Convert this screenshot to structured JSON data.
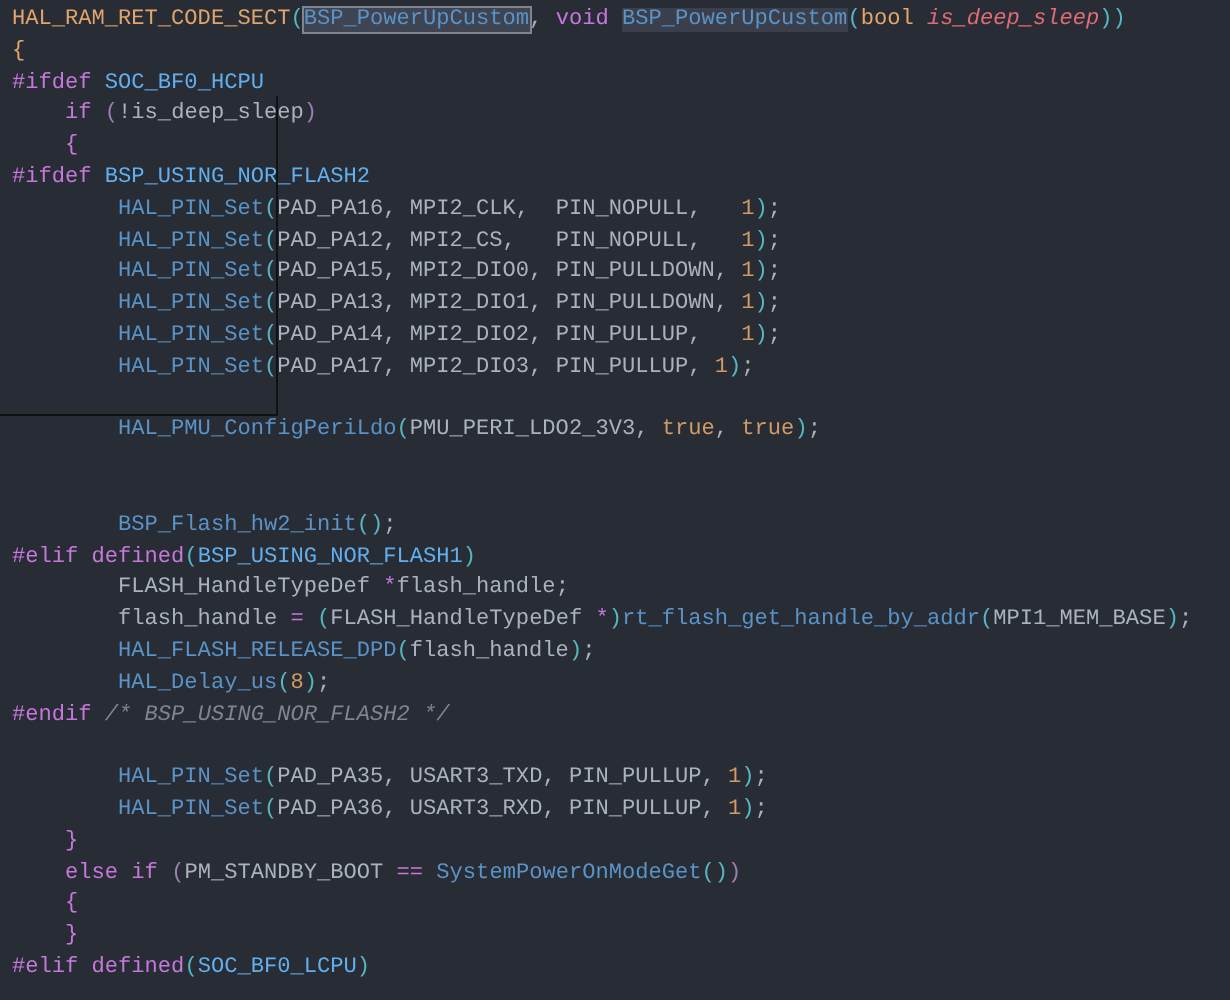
{
  "editor": {
    "lines": [
      {
        "kind": "code",
        "tokens": [
          {
            "text": "HAL_RAM_RET_CODE_SECT",
            "kind": "macro"
          },
          {
            "text": "(",
            "kind": "punct"
          },
          {
            "text": "BSP_PowerUpCustom",
            "kind": "func",
            "selected": true
          },
          {
            "text": ", ",
            "kind": "plain"
          },
          {
            "text": "void ",
            "kind": "keyword"
          },
          {
            "text": "BSP_PowerUpCustom",
            "kind": "func",
            "highlighted": true
          },
          {
            "text": "(",
            "kind": "punct"
          },
          {
            "text": "bool ",
            "kind": "type"
          },
          {
            "text": "is_deep_sleep",
            "kind": "param"
          },
          {
            "text": "))",
            "kind": "punct"
          }
        ]
      },
      {
        "kind": "code",
        "tokens": [
          {
            "text": "{",
            "kind": "type"
          }
        ]
      },
      {
        "kind": "code",
        "tokens": [
          {
            "text": "#ifdef",
            "kind": "keyword"
          },
          {
            "text": " SOC_BF0_HCPU",
            "kind": "defname"
          }
        ]
      },
      {
        "kind": "code",
        "tokens": [
          {
            "text": "    if ",
            "kind": "keyword"
          },
          {
            "text": "(",
            "kind": "dimpunct"
          },
          {
            "text": "!is_deep_sleep",
            "kind": "plain"
          },
          {
            "text": ")",
            "kind": "dimpunct"
          }
        ]
      },
      {
        "kind": "code",
        "tokens": [
          {
            "text": "    {",
            "kind": "keyword"
          }
        ]
      },
      {
        "kind": "code",
        "tokens": [
          {
            "text": "#ifdef",
            "kind": "keyword"
          },
          {
            "text": " BSP_USING_NOR_FLASH2",
            "kind": "defname"
          }
        ]
      },
      {
        "kind": "code",
        "tokens": [
          {
            "text": "        HAL_PIN_Set",
            "kind": "func"
          },
          {
            "text": "(",
            "kind": "punct"
          },
          {
            "text": "PAD_PA16, MPI2_CLK,  PIN_NOPULL,   ",
            "kind": "plain"
          },
          {
            "text": "1",
            "kind": "number"
          },
          {
            "text": ")",
            "kind": "punct"
          },
          {
            "text": ";",
            "kind": "plain"
          }
        ]
      },
      {
        "kind": "code",
        "tokens": [
          {
            "text": "        HAL_PIN_Set",
            "kind": "func"
          },
          {
            "text": "(",
            "kind": "punct"
          },
          {
            "text": "PAD_PA12, MPI2_CS,   PIN_NOPULL,   ",
            "kind": "plain"
          },
          {
            "text": "1",
            "kind": "number"
          },
          {
            "text": ")",
            "kind": "punct"
          },
          {
            "text": ";",
            "kind": "plain"
          }
        ]
      },
      {
        "kind": "code",
        "tokens": [
          {
            "text": "        HAL_PIN_Set",
            "kind": "func"
          },
          {
            "text": "(",
            "kind": "punct"
          },
          {
            "text": "PAD_PA15, MPI2_DIO0, PIN_PULLDOWN, ",
            "kind": "plain"
          },
          {
            "text": "1",
            "kind": "number"
          },
          {
            "text": ")",
            "kind": "punct"
          },
          {
            "text": ";",
            "kind": "plain"
          }
        ]
      },
      {
        "kind": "code",
        "tokens": [
          {
            "text": "        HAL_PIN_Set",
            "kind": "func"
          },
          {
            "text": "(",
            "kind": "punct"
          },
          {
            "text": "PAD_PA13, MPI2_DIO1, PIN_PULLDOWN, ",
            "kind": "plain"
          },
          {
            "text": "1",
            "kind": "number"
          },
          {
            "text": ")",
            "kind": "punct"
          },
          {
            "text": ";",
            "kind": "plain"
          }
        ]
      },
      {
        "kind": "code",
        "tokens": [
          {
            "text": "        HAL_PIN_Set",
            "kind": "func"
          },
          {
            "text": "(",
            "kind": "punct"
          },
          {
            "text": "PAD_PA14, MPI2_DIO2, PIN_PULLUP,   ",
            "kind": "plain"
          },
          {
            "text": "1",
            "kind": "number"
          },
          {
            "text": ")",
            "kind": "punct"
          },
          {
            "text": ";",
            "kind": "plain"
          }
        ]
      },
      {
        "kind": "code",
        "tokens": [
          {
            "text": "        HAL_PIN_Set",
            "kind": "func"
          },
          {
            "text": "(",
            "kind": "punct"
          },
          {
            "text": "PAD_PA17, MPI2_DIO3, PIN_PULLUP, ",
            "kind": "plain"
          },
          {
            "text": "1",
            "kind": "number"
          },
          {
            "text": ")",
            "kind": "punct"
          },
          {
            "text": ";",
            "kind": "plain"
          }
        ]
      },
      {
        "kind": "blank"
      },
      {
        "kind": "code",
        "tokens": [
          {
            "text": "        HAL_PMU_ConfigPeriLdo",
            "kind": "func"
          },
          {
            "text": "(",
            "kind": "punct"
          },
          {
            "text": "PMU_PERI_LDO2_3V3, ",
            "kind": "plain"
          },
          {
            "text": "true",
            "kind": "number"
          },
          {
            "text": ", ",
            "kind": "plain"
          },
          {
            "text": "true",
            "kind": "number"
          },
          {
            "text": ")",
            "kind": "punct"
          },
          {
            "text": ";",
            "kind": "plain"
          }
        ]
      },
      {
        "kind": "blank"
      },
      {
        "kind": "blank"
      },
      {
        "kind": "code",
        "tokens": [
          {
            "text": "        BSP_Flash_hw2_init",
            "kind": "func"
          },
          {
            "text": "()",
            "kind": "punct"
          },
          {
            "text": ";",
            "kind": "plain"
          }
        ]
      },
      {
        "kind": "code",
        "tokens": [
          {
            "text": "#elif defined",
            "kind": "keyword"
          },
          {
            "text": "(",
            "kind": "punct"
          },
          {
            "text": "BSP_USING_NOR_FLASH1",
            "kind": "defname"
          },
          {
            "text": ")",
            "kind": "punct"
          }
        ]
      },
      {
        "kind": "code",
        "tokens": [
          {
            "text": "        FLASH_HandleTypeDef ",
            "kind": "plain"
          },
          {
            "text": "*",
            "kind": "keyword"
          },
          {
            "text": "flash_handle;",
            "kind": "plain"
          }
        ]
      },
      {
        "kind": "code",
        "tokens": [
          {
            "text": "        flash_handle ",
            "kind": "plain"
          },
          {
            "text": "= ",
            "kind": "keyword"
          },
          {
            "text": "(",
            "kind": "punct"
          },
          {
            "text": "FLASH_HandleTypeDef ",
            "kind": "plain"
          },
          {
            "text": "*",
            "kind": "keyword"
          },
          {
            "text": ")",
            "kind": "punct"
          },
          {
            "text": "rt_flash_get_handle_by_addr",
            "kind": "func"
          },
          {
            "text": "(",
            "kind": "punct"
          },
          {
            "text": "MPI1_MEM_BASE",
            "kind": "plain"
          },
          {
            "text": ")",
            "kind": "punct"
          },
          {
            "text": ";",
            "kind": "plain"
          }
        ]
      },
      {
        "kind": "code",
        "tokens": [
          {
            "text": "        HAL_FLASH_RELEASE_DPD",
            "kind": "func"
          },
          {
            "text": "(",
            "kind": "punct"
          },
          {
            "text": "flash_handle",
            "kind": "plain"
          },
          {
            "text": ")",
            "kind": "punct"
          },
          {
            "text": ";",
            "kind": "plain"
          }
        ]
      },
      {
        "kind": "code",
        "tokens": [
          {
            "text": "        HAL_Delay_us",
            "kind": "func"
          },
          {
            "text": "(",
            "kind": "punct"
          },
          {
            "text": "8",
            "kind": "number"
          },
          {
            "text": ")",
            "kind": "punct"
          },
          {
            "text": ";",
            "kind": "plain"
          }
        ]
      },
      {
        "kind": "code",
        "tokens": [
          {
            "text": "#endif",
            "kind": "keyword"
          },
          {
            "text": " /* BSP_USING_NOR_FLASH2 */",
            "kind": "comment"
          }
        ]
      },
      {
        "kind": "blank"
      },
      {
        "kind": "code",
        "tokens": [
          {
            "text": "        HAL_PIN_Set",
            "kind": "func"
          },
          {
            "text": "(",
            "kind": "punct"
          },
          {
            "text": "PAD_PA35, USART3_TXD, PIN_PULLUP, ",
            "kind": "plain"
          },
          {
            "text": "1",
            "kind": "number"
          },
          {
            "text": ")",
            "kind": "punct"
          },
          {
            "text": ";",
            "kind": "plain"
          }
        ]
      },
      {
        "kind": "code",
        "tokens": [
          {
            "text": "        HAL_PIN_Set",
            "kind": "func"
          },
          {
            "text": "(",
            "kind": "punct"
          },
          {
            "text": "PAD_PA36, USART3_RXD, PIN_PULLUP, ",
            "kind": "plain"
          },
          {
            "text": "1",
            "kind": "number"
          },
          {
            "text": ")",
            "kind": "punct"
          },
          {
            "text": ";",
            "kind": "plain"
          }
        ]
      },
      {
        "kind": "code",
        "tokens": [
          {
            "text": "    }",
            "kind": "keyword"
          }
        ]
      },
      {
        "kind": "code",
        "tokens": [
          {
            "text": "    else if ",
            "kind": "keyword"
          },
          {
            "text": "(",
            "kind": "dimpunct"
          },
          {
            "text": "PM_STANDBY_BOOT ",
            "kind": "plain"
          },
          {
            "text": "== ",
            "kind": "keyword"
          },
          {
            "text": "SystemPowerOnModeGet",
            "kind": "func"
          },
          {
            "text": "()",
            "kind": "punct"
          },
          {
            "text": ")",
            "kind": "dimpunct"
          }
        ]
      },
      {
        "kind": "code",
        "tokens": [
          {
            "text": "    {",
            "kind": "keyword"
          }
        ]
      },
      {
        "kind": "code",
        "tokens": [
          {
            "text": "    }",
            "kind": "keyword"
          }
        ]
      },
      {
        "kind": "code",
        "tokens": [
          {
            "text": "#elif defined",
            "kind": "keyword"
          },
          {
            "text": "(",
            "kind": "punct"
          },
          {
            "text": "SOC_BF0_LCPU",
            "kind": "defname"
          },
          {
            "text": ")",
            "kind": "punct"
          }
        ]
      }
    ]
  }
}
